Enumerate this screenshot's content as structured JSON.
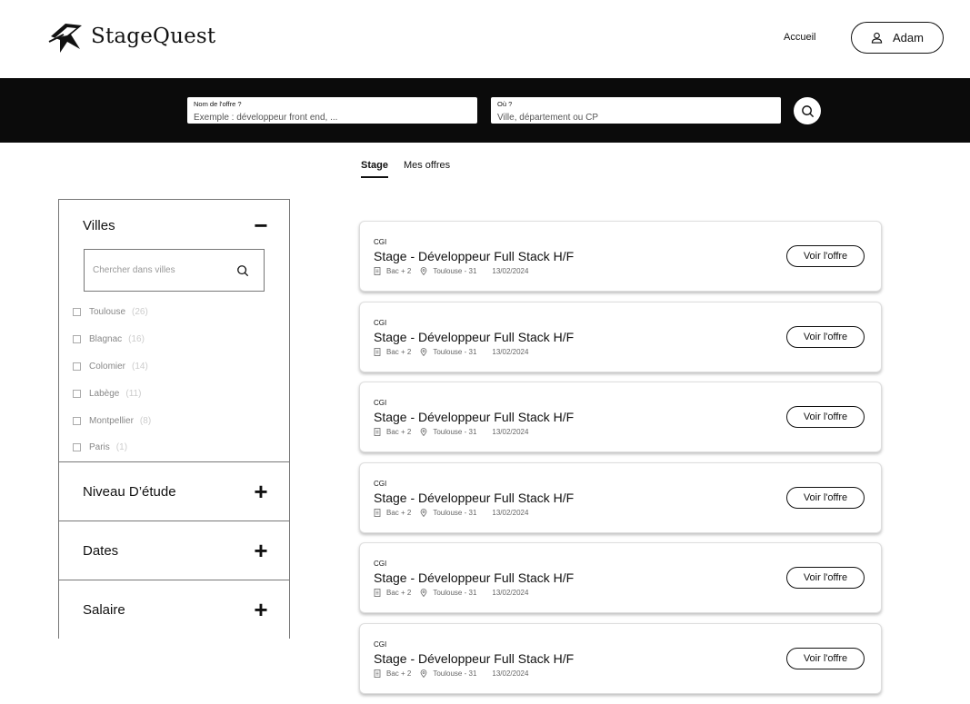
{
  "header": {
    "logo_text": "StageQuest",
    "home_link": "Accueil",
    "user_name": "Adam"
  },
  "search": {
    "offer_label": "Nom de l'offre ?",
    "offer_placeholder": "Exemple : développeur front end, ...",
    "where_label": "Où ?",
    "where_placeholder": "Ville, département ou CP"
  },
  "tabs": [
    {
      "label": "Stage",
      "active": true
    },
    {
      "label": "Mes offres",
      "active": false
    }
  ],
  "filters": {
    "villes": {
      "title": "Villes",
      "search_placeholder": "Chercher dans villes",
      "cities": [
        {
          "name": "Toulouse",
          "count": "(26)"
        },
        {
          "name": "Blagnac",
          "count": "(16)"
        },
        {
          "name": "Colomier",
          "count": "(14)"
        },
        {
          "name": "Labège",
          "count": "(11)"
        },
        {
          "name": "Montpellier",
          "count": "(8)"
        },
        {
          "name": "Paris",
          "count": "(1)"
        }
      ]
    },
    "niveau": {
      "title": "Niveau D’étude"
    },
    "dates": {
      "title": "Dates"
    },
    "salaire": {
      "title": "Salaire"
    }
  },
  "offers": [
    {
      "company": "CGI",
      "title": "Stage - Développeur Full Stack H/F",
      "level": "Bac + 2",
      "location": "Toulouse - 31",
      "date": "13/02/2024",
      "button": "Voir l'offre"
    },
    {
      "company": "CGI",
      "title": "Stage - Développeur Full Stack H/F",
      "level": "Bac + 2",
      "location": "Toulouse - 31",
      "date": "13/02/2024",
      "button": "Voir l'offre"
    },
    {
      "company": "CGI",
      "title": "Stage - Développeur Full Stack H/F",
      "level": "Bac + 2",
      "location": "Toulouse - 31",
      "date": "13/02/2024",
      "button": "Voir l'offre"
    },
    {
      "company": "CGI",
      "title": "Stage - Développeur Full Stack H/F",
      "level": "Bac + 2",
      "location": "Toulouse - 31",
      "date": "13/02/2024",
      "button": "Voir l'offre"
    },
    {
      "company": "CGI",
      "title": "Stage - Développeur Full Stack H/F",
      "level": "Bac + 2",
      "location": "Toulouse - 31",
      "date": "13/02/2024",
      "button": "Voir l'offre"
    },
    {
      "company": "CGI",
      "title": "Stage - Développeur Full Stack H/F",
      "level": "Bac + 2",
      "location": "Toulouse - 31",
      "date": "13/02/2024",
      "button": "Voir l'offre"
    }
  ]
}
